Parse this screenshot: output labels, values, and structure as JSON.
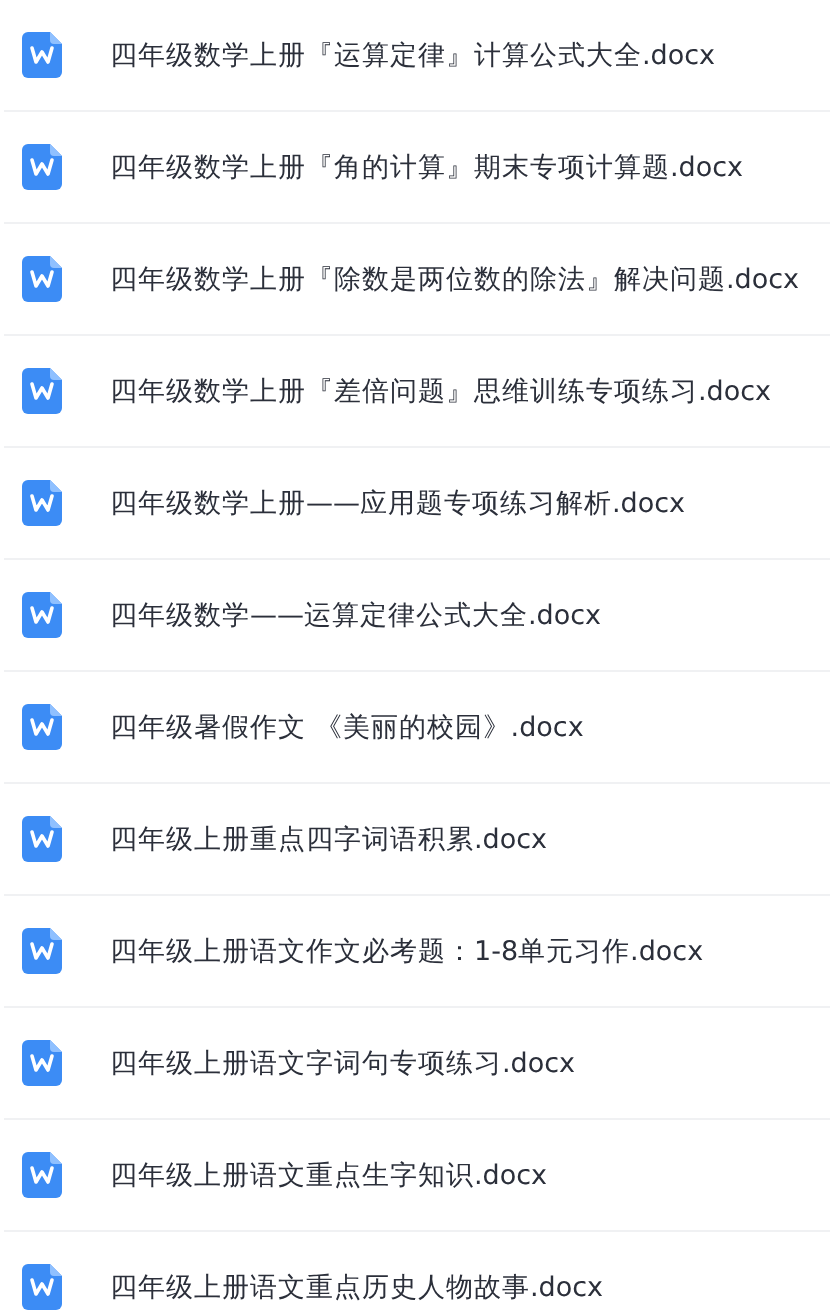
{
  "files": [
    {
      "name": "四年级数学上册『运算定律』计算公式大全.docx",
      "kind": "word"
    },
    {
      "name": "四年级数学上册『角的计算』期末专项计算题.docx",
      "kind": "word"
    },
    {
      "name": "四年级数学上册『除数是两位数的除法』解决问题.docx",
      "kind": "word"
    },
    {
      "name": "四年级数学上册『差倍问题』思维训练专项练习.docx",
      "kind": "word"
    },
    {
      "name": "四年级数学上册——应用题专项练习解析.docx",
      "kind": "word"
    },
    {
      "name": "四年级数学——运算定律公式大全.docx",
      "kind": "word"
    },
    {
      "name": "四年级暑假作文 《美丽的校园》.docx",
      "kind": "word"
    },
    {
      "name": "四年级上册重点四字词语积累.docx",
      "kind": "word"
    },
    {
      "name": "四年级上册语文作文必考题：1-8单元习作.docx",
      "kind": "word"
    },
    {
      "name": "四年级上册语文字词句专项练习.docx",
      "kind": "word"
    },
    {
      "name": "四年级上册语文重点生字知识.docx",
      "kind": "word"
    },
    {
      "name": "四年级上册语文重点历史人物故事.docx",
      "kind": "word"
    }
  ]
}
